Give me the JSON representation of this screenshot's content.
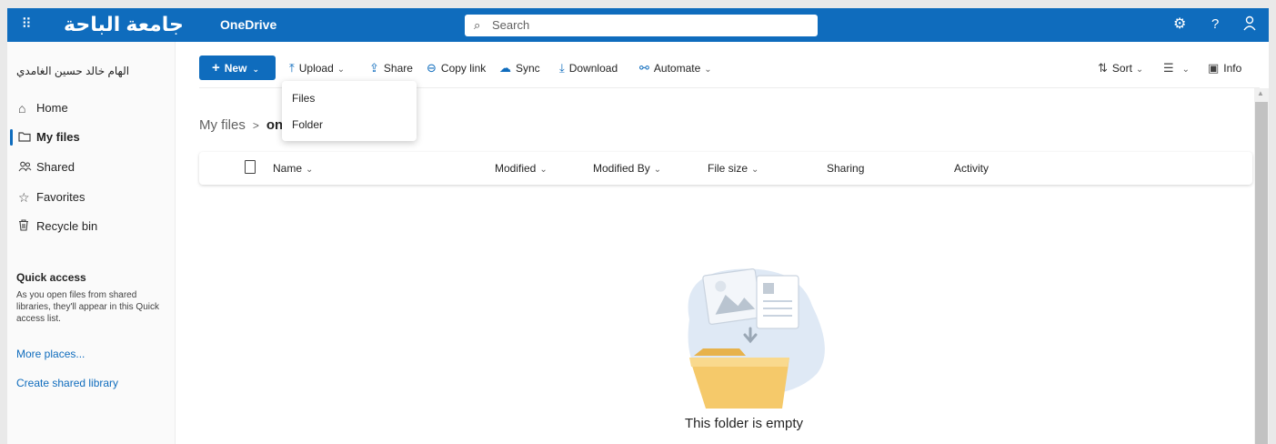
{
  "topbar": {
    "waffle_icon": "waffle-grid-icon",
    "org_name": "جامعة الباحة",
    "app_name": "OneDrive",
    "search_placeholder": "Search",
    "settings_icon": "gear-icon",
    "help_label": "?",
    "account_icon": "person-icon",
    "background_color": "#0f6cbd"
  },
  "sidebar": {
    "user_name": "الهام خالد حسين الغامدي",
    "nav": [
      {
        "label": "Home",
        "icon": "home-icon"
      },
      {
        "label": "My files",
        "icon": "folder-icon",
        "active": true
      },
      {
        "label": "Shared",
        "icon": "people-icon"
      },
      {
        "label": "Favorites",
        "icon": "star-icon"
      },
      {
        "label": "Recycle bin",
        "icon": "trash-icon"
      }
    ],
    "quick_access": {
      "title": "Quick access",
      "description": "As you open files from shared libraries, they'll appear in this Quick access list.",
      "more_places": "More places...",
      "create_library": "Create shared library"
    }
  },
  "commandbar": {
    "new_label": "New",
    "upload_label": "Upload",
    "share_label": "Share",
    "copy_link_label": "Copy link",
    "sync_label": "Sync",
    "download_label": "Download",
    "automate_label": "Automate",
    "sort_label": "Sort",
    "info_label": "Info"
  },
  "upload_menu": {
    "items": [
      "Files",
      "Folder"
    ]
  },
  "breadcrumb": {
    "root": "My files",
    "current": "on"
  },
  "list_header": {
    "columns": [
      "Name",
      "Modified",
      "Modified By",
      "File size",
      "Sharing",
      "Activity"
    ]
  },
  "empty_state": {
    "message": "This folder is empty"
  },
  "colors": {
    "accent": "#0f6cbd",
    "folder": "#f5c96a",
    "blob": "#dfe9f5"
  }
}
